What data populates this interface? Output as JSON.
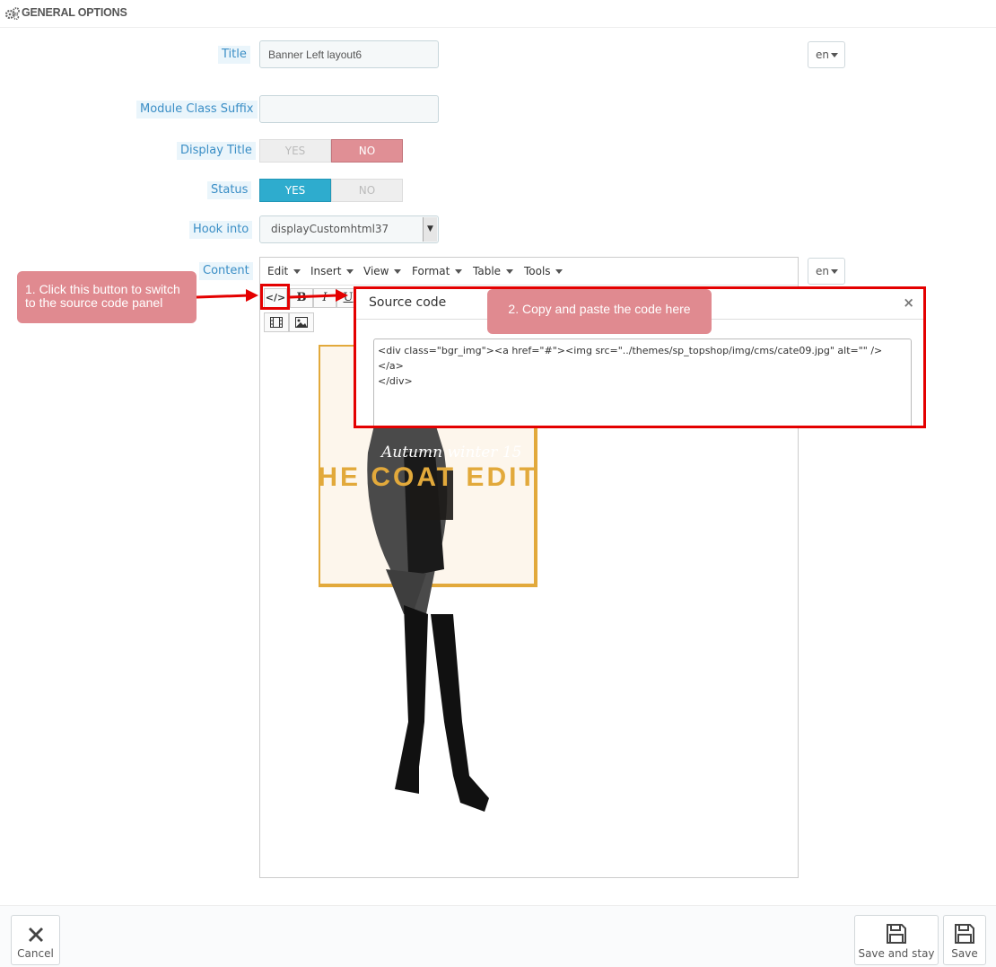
{
  "panel": {
    "title": "GENERAL OPTIONS"
  },
  "form": {
    "title_label": "Title",
    "title_value": "Banner Left layout6",
    "lang": "en",
    "suffix_label": "Module Class Suffix",
    "suffix_value": "",
    "display_title_label": "Display Title",
    "display_title": {
      "yes": "YES",
      "no": "NO",
      "selected": "NO"
    },
    "status_label": "Status",
    "status": {
      "yes": "YES",
      "no": "NO",
      "selected": "YES"
    },
    "hook_label": "Hook into",
    "hook_value": "displayCustomhtml37",
    "content_label": "Content"
  },
  "editor": {
    "menus": [
      "Edit",
      "Insert",
      "View",
      "Format",
      "Table",
      "Tools"
    ],
    "lang": "en",
    "banner_script": "Autumn winter 15",
    "banner_title": "THE COAT EDIT"
  },
  "dialog": {
    "title": "Source code",
    "close": "×",
    "code": "<div class=\"bgr_img\"><a href=\"#\"><img src=\"../themes/sp_topshop/img/cms/cate09.jpg\" alt=\"\" /></a>\n</div>"
  },
  "callouts": {
    "step1": "1. Click this button to switch to the source code panel",
    "step2": "2. Copy and paste the code here"
  },
  "footer": {
    "cancel": "Cancel",
    "save_stay": "Save and stay",
    "save": "Save"
  },
  "colors": {
    "accent_blue": "#2eacce",
    "no_red": "#e08f95",
    "highlight_red": "#e40000",
    "gold": "#e2a93b"
  }
}
